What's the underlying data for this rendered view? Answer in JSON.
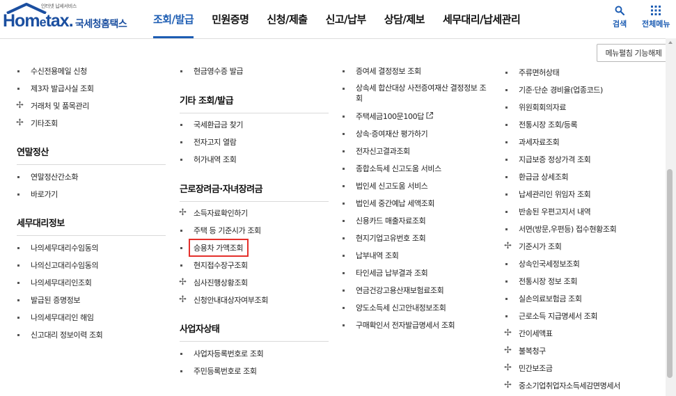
{
  "header": {
    "logo_tagline": "인터넷 납세서비스",
    "logo_word_left": "Hom",
    "logo_word_e": "e",
    "logo_word_right": "tax.",
    "logo_korean": "국세청홈택스",
    "nav": [
      "조회/발급",
      "민원증명",
      "신청/제출",
      "신고/납부",
      "상담/제보",
      "세무대리/납세관리"
    ],
    "search_label": "검색",
    "allmenu_label": "전체메뉴",
    "accent": "#1d5db3"
  },
  "menu_toggle_label": "메뉴펼침 기능해제",
  "col1": {
    "items_a": [
      {
        "label": "수신전용메일 신청",
        "type": "bullet"
      },
      {
        "label": "제3자 발급사실 조회",
        "type": "bullet"
      },
      {
        "label": "거래처 및 품목관리",
        "type": "plus"
      },
      {
        "label": "기타조회",
        "type": "plus"
      }
    ],
    "heading_b": "연말정산",
    "items_b": [
      {
        "label": "연말정산간소화",
        "type": "bullet"
      },
      {
        "label": "바로가기",
        "type": "bullet"
      }
    ],
    "heading_c": "세무대리정보",
    "items_c": [
      {
        "label": "나의세무대리수임동의",
        "type": "bullet"
      },
      {
        "label": "나의신고대리수임동의",
        "type": "bullet"
      },
      {
        "label": "나의세무대리인조회",
        "type": "bullet"
      },
      {
        "label": "발급된 증명정보",
        "type": "bullet"
      },
      {
        "label": "나의세무대리인 해임",
        "type": "bullet"
      },
      {
        "label": "신고대리 정보이력 조회",
        "type": "bullet"
      }
    ]
  },
  "col2": {
    "items_a": [
      {
        "label": "현금영수증 발급",
        "type": "bullet"
      }
    ],
    "heading_b": "기타 조회/발급",
    "items_b": [
      {
        "label": "국세환급금 찾기",
        "type": "bullet"
      },
      {
        "label": "전자고지 열람",
        "type": "bullet"
      },
      {
        "label": "허가내역 조회",
        "type": "bullet"
      }
    ],
    "heading_c": "근로장려금·자녀장려금",
    "items_c": [
      {
        "label": "소득자료확인하기",
        "type": "plus"
      },
      {
        "label": "주택 등 기준시가 조회",
        "type": "bullet"
      },
      {
        "label": "승용차 가액조회",
        "type": "bullet"
      },
      {
        "label": "현지접수장구조회",
        "type": "bullet"
      },
      {
        "label": "심사진행상황조회",
        "type": "plus"
      },
      {
        "label": "신청안내대상자여부조회",
        "type": "plus"
      }
    ],
    "heading_d": "사업자상태",
    "items_d": [
      {
        "label": "사업자등록번호로 조회",
        "type": "bullet"
      },
      {
        "label": "주민등록번호로 조회",
        "type": "bullet"
      }
    ]
  },
  "col3": {
    "items": [
      {
        "label": "증여세 결정정보 조회",
        "type": "bullet"
      },
      {
        "label": "상속세 합산대상 사전증여재산 결정정보 조회",
        "type": "bullet"
      },
      {
        "label": "주택세금100문100답",
        "type": "bullet"
      },
      {
        "label": "상속·증여재산 평가하기",
        "type": "bullet"
      },
      {
        "label": "전자신고결과조회",
        "type": "bullet"
      },
      {
        "label": "종합소득세 신고도움 서비스",
        "type": "bullet"
      },
      {
        "label": "법인세 신고도움 서비스",
        "type": "bullet"
      },
      {
        "label": "법인세 중간예납 세액조회",
        "type": "bullet"
      },
      {
        "label": "신용카드 매출자료조회",
        "type": "bullet"
      },
      {
        "label": "현지기업고유번호 조회",
        "type": "bullet"
      },
      {
        "label": "납부내역 조회",
        "type": "bullet"
      },
      {
        "label": "타인세금 납부결과 조회",
        "type": "bullet"
      },
      {
        "label": "연금건강고용산재보험료조회",
        "type": "bullet"
      },
      {
        "label": "양도소득세 신고안내정보조회",
        "type": "bullet"
      },
      {
        "label": "구매확인서 전자발급명세서 조회",
        "type": "bullet"
      }
    ]
  },
  "col4": {
    "items": [
      {
        "label": "주류면허상태",
        "type": "bullet"
      },
      {
        "label": "기준·단순 경비율(업종코드)",
        "type": "bullet"
      },
      {
        "label": "위원회회의자료",
        "type": "bullet"
      },
      {
        "label": "전통시장 조회/등록",
        "type": "bullet"
      },
      {
        "label": "과세자료조회",
        "type": "bullet"
      },
      {
        "label": "지급보증 정상가격 조회",
        "type": "bullet"
      },
      {
        "label": "환급금 상세조회",
        "type": "bullet"
      },
      {
        "label": "납세관리인 위임자 조회",
        "type": "bullet"
      },
      {
        "label": "반송된 우편고지서 내역",
        "type": "bullet"
      },
      {
        "label": "서면(방문,우편등) 접수현황조회",
        "type": "bullet"
      },
      {
        "label": "기준시가 조회",
        "type": "plus"
      },
      {
        "label": "상속인국세정보조회",
        "type": "bullet"
      },
      {
        "label": "전통시장 정보 조회",
        "type": "bullet"
      },
      {
        "label": "실손의료보험금 조회",
        "type": "bullet"
      },
      {
        "label": "근로소득 지급명세서 조회",
        "type": "bullet"
      },
      {
        "label": "간이세액표",
        "type": "plus"
      },
      {
        "label": "불복청구",
        "type": "plus"
      },
      {
        "label": "민간보조금",
        "type": "plus"
      },
      {
        "label": "중소기업취업자소득세감면명세서",
        "type": "plus"
      }
    ]
  },
  "highlight_color": "#e4302b"
}
